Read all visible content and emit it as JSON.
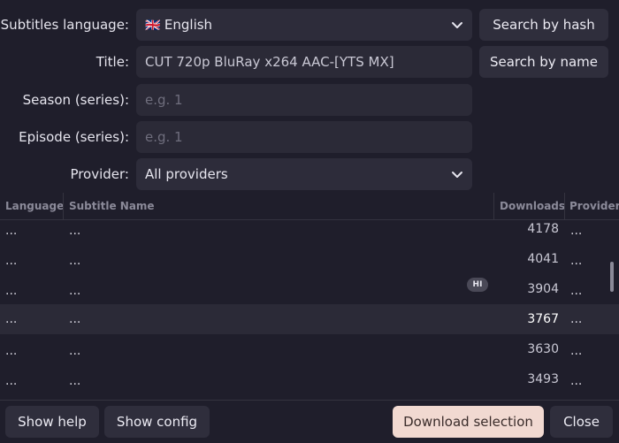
{
  "form": {
    "subtitles_language": {
      "label": "Subtitles language:",
      "flag": "🇬🇧",
      "value": "English"
    },
    "title": {
      "label": "Title:",
      "value": "CUT 720p BluRay x264 AAC-[YTS MX]"
    },
    "season": {
      "label": "Season (series):",
      "placeholder": "e.g. 1"
    },
    "episode": {
      "label": "Episode (series):",
      "placeholder": "e.g. 1"
    },
    "provider": {
      "label": "Provider:",
      "value": "All providers"
    }
  },
  "actions": {
    "search_by_hash": "Search by hash",
    "search_by_name": "Search by name"
  },
  "table": {
    "columns": {
      "language": "Language",
      "subtitle_name": "Subtitle Name",
      "downloads": "Downloads",
      "provider": "Provider"
    },
    "rows": [
      {
        "language": "...",
        "name": "...",
        "downloads": "4178",
        "provider": "...",
        "hi": ""
      },
      {
        "language": "...",
        "name": "...",
        "downloads": "4041",
        "provider": "...",
        "hi": ""
      },
      {
        "language": "...",
        "name": "...",
        "downloads": "3904",
        "provider": "...",
        "hi": "HI"
      },
      {
        "language": "...",
        "name": "...",
        "downloads": "3767",
        "provider": "...",
        "hi": "",
        "selected": true
      },
      {
        "language": "...",
        "name": "...",
        "downloads": "3630",
        "provider": "...",
        "hi": ""
      },
      {
        "language": "...",
        "name": "...",
        "downloads": "3493",
        "provider": "...",
        "hi": ""
      }
    ]
  },
  "footer": {
    "show_help": "Show help",
    "show_config": "Show config",
    "download_selection": "Download selection",
    "close": "Close"
  },
  "colors": {
    "background": "#1f1e2b",
    "field": "#2d2c3a",
    "button": "#2f2e3c",
    "primary_button": "#f1d9d1",
    "selected_row": "#2b2a37"
  },
  "icons": {
    "select_arrow": "chevron-down-icon"
  }
}
